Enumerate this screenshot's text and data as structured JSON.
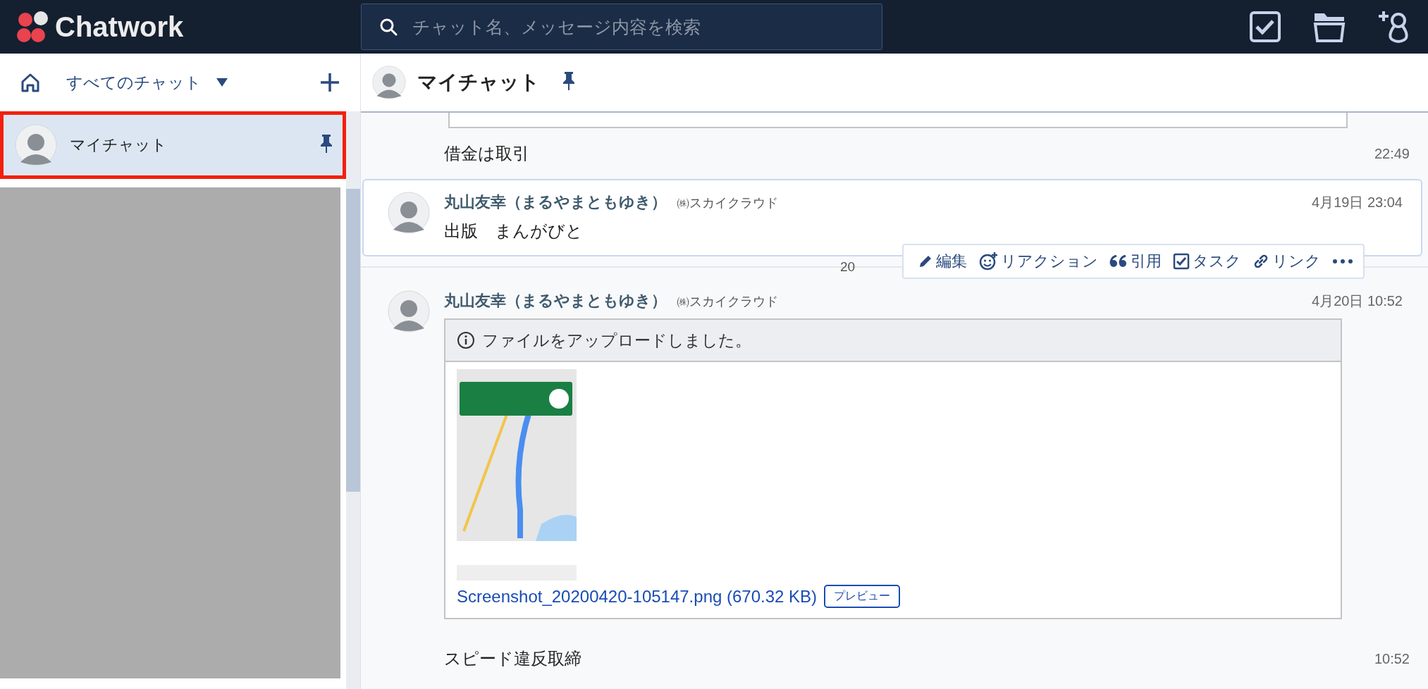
{
  "app": {
    "logo": "Chatwork"
  },
  "search": {
    "placeholder": "チャット名、メッセージ内容を検索"
  },
  "sidebar": {
    "filter": "すべてのチャット",
    "items": [
      {
        "name": "マイチャット",
        "pinned": true,
        "selected": true
      }
    ]
  },
  "chat": {
    "title": "マイチャット",
    "pinned": true
  },
  "messages": [
    {
      "kind": "continuation",
      "body": "借金は取引",
      "time": "22:49"
    },
    {
      "kind": "full",
      "hovered": true,
      "sender": "丸山友幸（まるやまともゆき）",
      "org": "㈱スカイクラウド",
      "time": "4月19日 23:04",
      "body": "出版　まんがびと"
    },
    {
      "kind": "divider",
      "label": "20"
    },
    {
      "kind": "file",
      "hovered": false,
      "sender": "丸山友幸（まるやまともゆき）",
      "org": "㈱スカイクラウド",
      "time": "4月20日 10:52",
      "notice": "ファイルをアップロードしました。",
      "filename": "Screenshot_20200420-105147.png (670.32 KB)",
      "preview": "プレビュー"
    },
    {
      "kind": "continuation",
      "body": "スピード違反取締",
      "time": "10:52"
    }
  ],
  "actions": [
    {
      "kind": "edit",
      "label": "編集"
    },
    {
      "kind": "reaction",
      "label": "リアクション"
    },
    {
      "kind": "quote",
      "label": "引用"
    },
    {
      "kind": "task",
      "label": "タスク"
    },
    {
      "kind": "link",
      "label": "リンク"
    },
    {
      "kind": "more"
    }
  ]
}
